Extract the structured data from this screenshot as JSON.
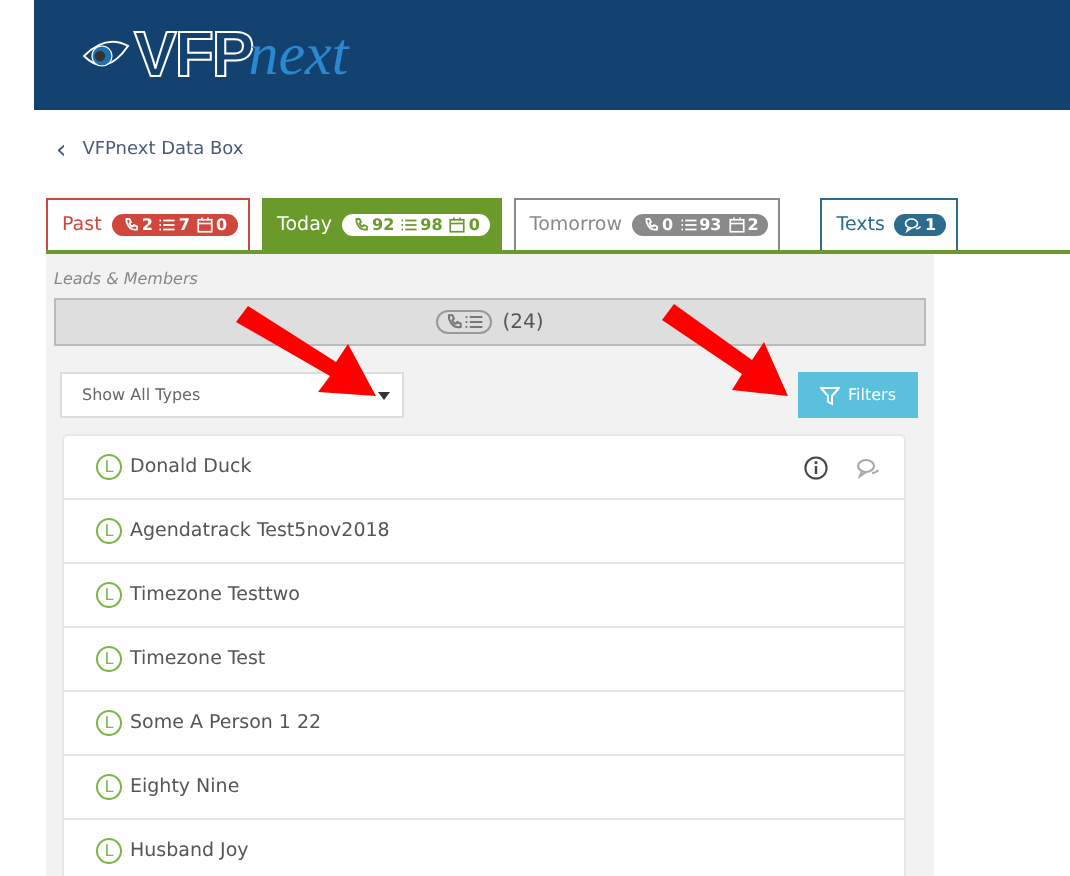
{
  "header": {
    "logo_main": "VFP",
    "logo_accent": "next"
  },
  "breadcrumb": {
    "back": "‹",
    "label": "VFPnext Data Box"
  },
  "tabs": [
    {
      "label": "Past",
      "selected": false,
      "color": "#d0483d",
      "counts": [
        {
          "kind": "phone",
          "value": "2"
        },
        {
          "kind": "list",
          "value": "7"
        },
        {
          "kind": "calendar",
          "value": "0"
        }
      ]
    },
    {
      "label": "Today",
      "selected": true,
      "color": "#6a9a2a",
      "counts": [
        {
          "kind": "phone",
          "value": "92"
        },
        {
          "kind": "list",
          "value": "98"
        },
        {
          "kind": "calendar",
          "value": "0"
        }
      ]
    },
    {
      "label": "Tomorrow",
      "selected": false,
      "color": "#8a8a8a",
      "counts": [
        {
          "kind": "phone",
          "value": "0"
        },
        {
          "kind": "list",
          "value": "93"
        },
        {
          "kind": "calendar",
          "value": "2"
        }
      ]
    },
    {
      "label": "Texts",
      "selected": false,
      "color": "#2c6a8e",
      "counts": [
        {
          "kind": "chat",
          "value": "1"
        }
      ]
    }
  ],
  "panel": {
    "title": "Leads & Members",
    "count": "(24)",
    "type_select": "Show All Types",
    "filters_button": "Filters"
  },
  "leads": [
    {
      "badge": "L",
      "name": "Donald Duck",
      "actions": true
    },
    {
      "badge": "L",
      "name": "Agendatrack Test5nov2018",
      "actions": false
    },
    {
      "badge": "L",
      "name": "Timezone Testtwo",
      "actions": false
    },
    {
      "badge": "L",
      "name": "Timezone Test",
      "actions": false
    },
    {
      "badge": "L",
      "name": "Some A Person 1 22",
      "actions": false
    },
    {
      "badge": "L",
      "name": "Eighty Nine",
      "actions": false
    },
    {
      "badge": "L",
      "name": "Husband Joy",
      "actions": false
    }
  ]
}
